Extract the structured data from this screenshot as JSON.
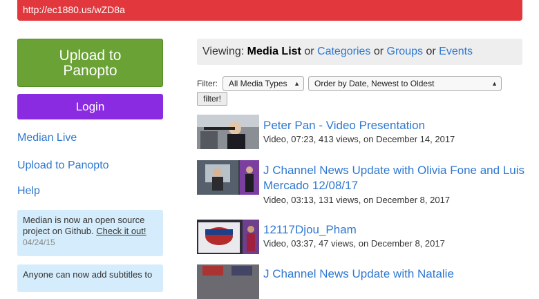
{
  "banner": {
    "text": "http://ec1880.us/wZD8a"
  },
  "sidebar": {
    "upload_button": "Upload to Panopto",
    "login_button": "Login",
    "links": [
      "Median Live",
      "Upload to Panopto",
      "Help"
    ],
    "notices": [
      {
        "text": "Median is now an open source project on Github.",
        "link": "Check it out!",
        "date": "04/24/15"
      },
      {
        "text": "Anyone can now add subtitles to"
      }
    ]
  },
  "viewing": {
    "label": "Viewing:",
    "current": "Media List",
    "or1": "or",
    "categories": "Categories",
    "or2": "or",
    "groups": "Groups",
    "or3": "or",
    "events": "Events"
  },
  "filter": {
    "label": "Filter:",
    "media_type": "All Media Types",
    "order": "Order by Date, Newest to Oldest",
    "button": "filter!"
  },
  "media": [
    {
      "title": "Peter Pan - Video Presentation",
      "meta": "Video, 07:23, 413 views, on December 14, 2017"
    },
    {
      "title": "J Channel News Update with Olivia Fone and Luis Mercado 12/08/17",
      "meta": "Video, 03:13, 131 views, on December 8, 2017"
    },
    {
      "title": "12117Djou_Pham",
      "meta": "Video, 03:37, 47 views, on December 8, 2017"
    },
    {
      "title": "J Channel News Update with Natalie",
      "meta": ""
    }
  ],
  "colors": {
    "banner": "#e2373c",
    "upload": "#6aa235",
    "login": "#8a2be2",
    "link": "#2f78d0",
    "notice": "#d4ecfb"
  }
}
